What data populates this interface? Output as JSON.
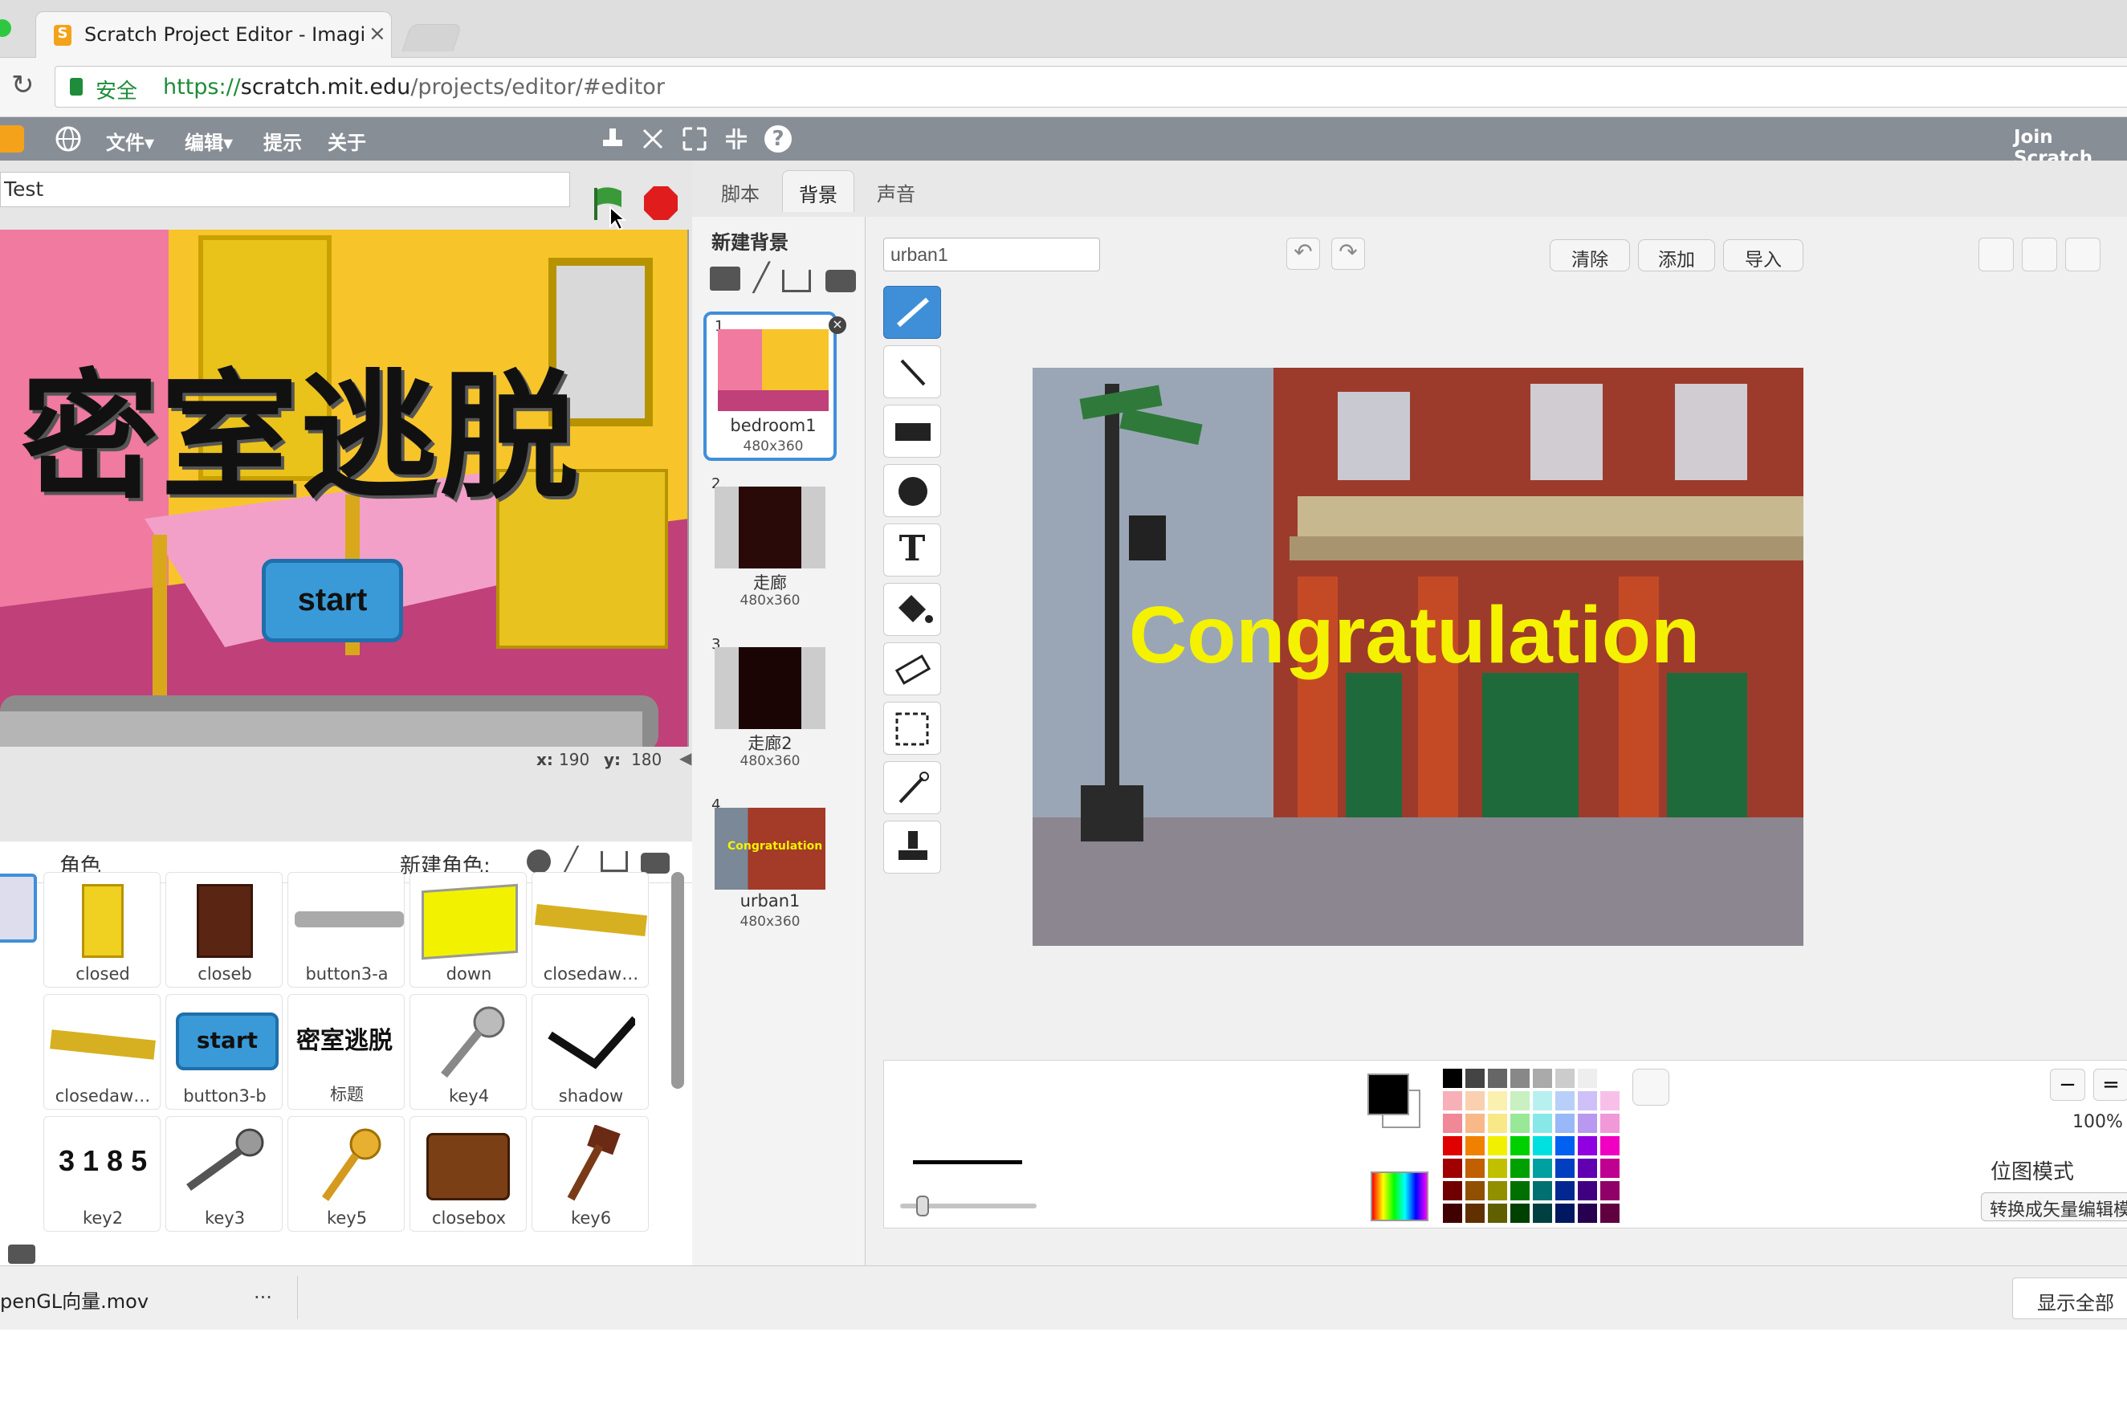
{
  "browser": {
    "tab_title": "Scratch Project Editor - Imagin",
    "secure_label": "安全",
    "url_scheme": "https://",
    "url_host": "scratch.mit.edu",
    "url_path": "/projects/editor/#editor"
  },
  "menubar": {
    "file": "文件▾",
    "edit": "编辑▾",
    "tips": "提示",
    "about": "关于",
    "join": "Join Scratch"
  },
  "stage": {
    "project_title": "Test",
    "title_text": "密室逃脱",
    "start_label": "start",
    "x_label": "x:",
    "x_value": "190",
    "y_label": "y:",
    "y_value": "180"
  },
  "sprites": {
    "header": "角色",
    "new_sprite": "新建角色:",
    "items": [
      {
        "label": "closed"
      },
      {
        "label": "closeb"
      },
      {
        "label": "button3-a"
      },
      {
        "label": "down"
      },
      {
        "label": "closedaw…"
      },
      {
        "label": "closedaw…"
      },
      {
        "label": "button3-b",
        "thumb_text": "start"
      },
      {
        "label": "标题",
        "thumb_text": "密室逃脱"
      },
      {
        "label": "key4"
      },
      {
        "label": "shadow"
      },
      {
        "label": "key2",
        "thumb_text": "3185"
      },
      {
        "label": "key3"
      },
      {
        "label": "key5"
      },
      {
        "label": "closebox"
      },
      {
        "label": "key6"
      }
    ]
  },
  "editor": {
    "tabs": [
      "脚本",
      "背景",
      "声音"
    ],
    "new_backdrop": "新建背景",
    "backdrops": [
      {
        "num": "1",
        "name": "bedroom1",
        "size": "480x360"
      },
      {
        "num": "2",
        "name": "走廊",
        "size": "480x360"
      },
      {
        "num": "3",
        "name": "走廊2",
        "size": "480x360"
      },
      {
        "num": "4",
        "name": "urban1",
        "size": "480x360"
      }
    ],
    "costume_name": "urban1",
    "clear": "清除",
    "add": "添加",
    "import": "导入",
    "canvas_text": "Congratulation",
    "zoom": "100%",
    "mode": "位图模式",
    "convert": "转换成矢量编辑模式",
    "thumb_text": "Congratulation"
  },
  "downloads": {
    "file": "penGL向量.mov",
    "more": "...",
    "show_all": "显示全部"
  },
  "colors": {
    "menubar": "#888e96",
    "selection": "#3f8fd8",
    "start_button": "#3a9ad8",
    "congrats_text": "#f5f200"
  }
}
